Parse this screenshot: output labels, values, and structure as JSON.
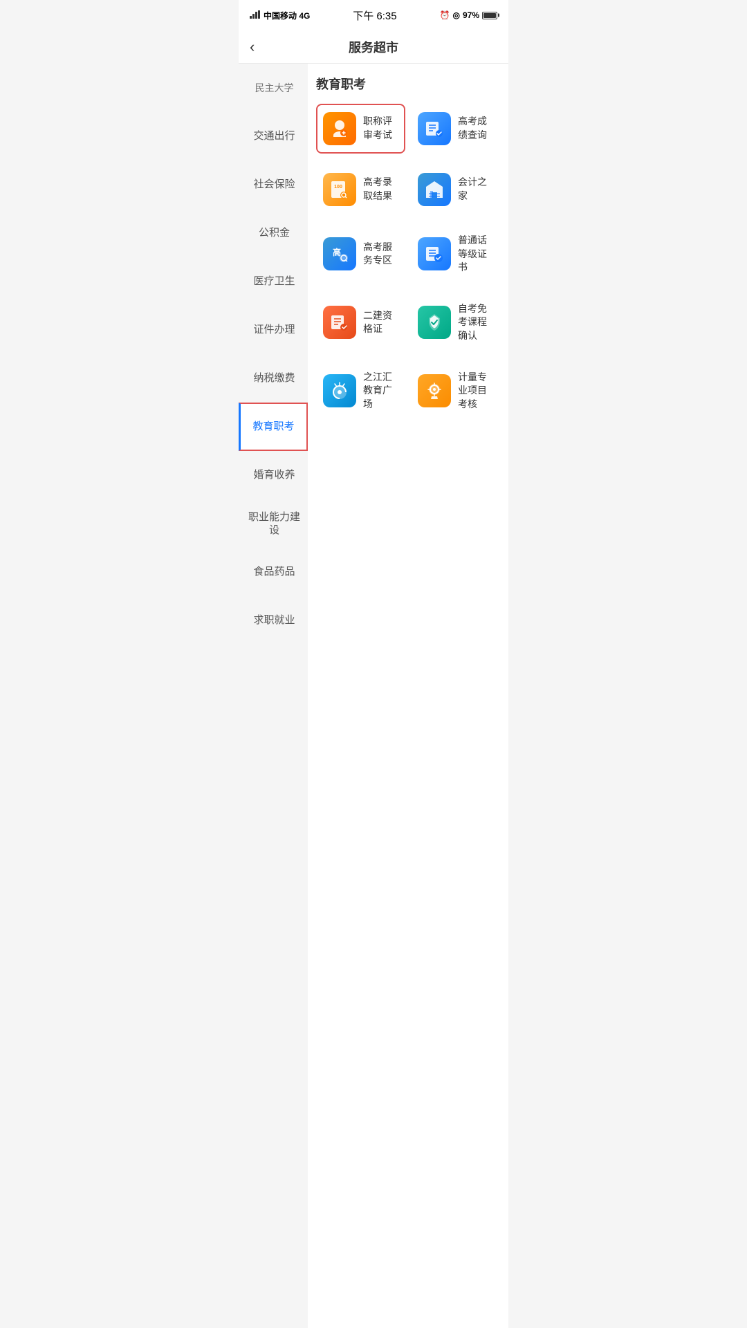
{
  "statusBar": {
    "carrier": "中国移动 4G",
    "time": "下午 6:35",
    "battery": "97%"
  },
  "header": {
    "backLabel": "‹",
    "title": "服务超市"
  },
  "sidebar": {
    "items": [
      {
        "id": "civil",
        "label": "民主大学",
        "active": false,
        "partial": true
      },
      {
        "id": "traffic",
        "label": "交通出行",
        "active": false
      },
      {
        "id": "insurance",
        "label": "社会保险",
        "active": false
      },
      {
        "id": "fund",
        "label": "公积金",
        "active": false
      },
      {
        "id": "medical",
        "label": "医疗卫生",
        "active": false
      },
      {
        "id": "certificate",
        "label": "证件办理",
        "active": false
      },
      {
        "id": "tax",
        "label": "纳税缴费",
        "active": false
      },
      {
        "id": "education",
        "label": "教育职考",
        "active": true
      },
      {
        "id": "marriage",
        "label": "婚育收养",
        "active": false
      },
      {
        "id": "career",
        "label": "职业能力建设",
        "active": false
      },
      {
        "id": "food",
        "label": "食品药品",
        "active": false
      },
      {
        "id": "job",
        "label": "求职就业",
        "active": false
      }
    ]
  },
  "content": {
    "sectionTitle": "教育职考",
    "services": [
      {
        "id": "title-exam",
        "label": "职称评审考试",
        "iconType": "orange",
        "highlighted": true,
        "iconName": "person-badge-icon"
      },
      {
        "id": "gaokao-result",
        "label": "高考成绩查询",
        "iconType": "blue",
        "highlighted": false,
        "iconName": "search-list-icon"
      },
      {
        "id": "gaokao-admission",
        "label": "高考录取结果",
        "iconType": "orange2",
        "highlighted": false,
        "iconName": "exam-search-icon"
      },
      {
        "id": "accounting",
        "label": "会计之家",
        "iconType": "blue-dark",
        "highlighted": false,
        "iconName": "house-list-icon"
      },
      {
        "id": "gaokao-service",
        "label": "高考服务专区",
        "iconType": "blue",
        "highlighted": false,
        "iconName": "gaokao-service-icon"
      },
      {
        "id": "putonghua",
        "label": "普通话等级证书",
        "iconType": "blue",
        "highlighted": false,
        "iconName": "certificate-icon"
      },
      {
        "id": "second-builder",
        "label": "二建资格证",
        "iconType": "red-orange",
        "highlighted": false,
        "iconName": "list-check-icon"
      },
      {
        "id": "self-study",
        "label": "自考免考课程确认",
        "iconType": "teal",
        "highlighted": false,
        "iconName": "graduation-icon"
      },
      {
        "id": "zhijiang",
        "label": "之江汇教育广场",
        "iconType": "cyan",
        "highlighted": false,
        "iconName": "education-icon"
      },
      {
        "id": "measurement",
        "label": "计量专业项目考核",
        "iconType": "orange3",
        "highlighted": false,
        "iconName": "measure-icon"
      }
    ]
  }
}
